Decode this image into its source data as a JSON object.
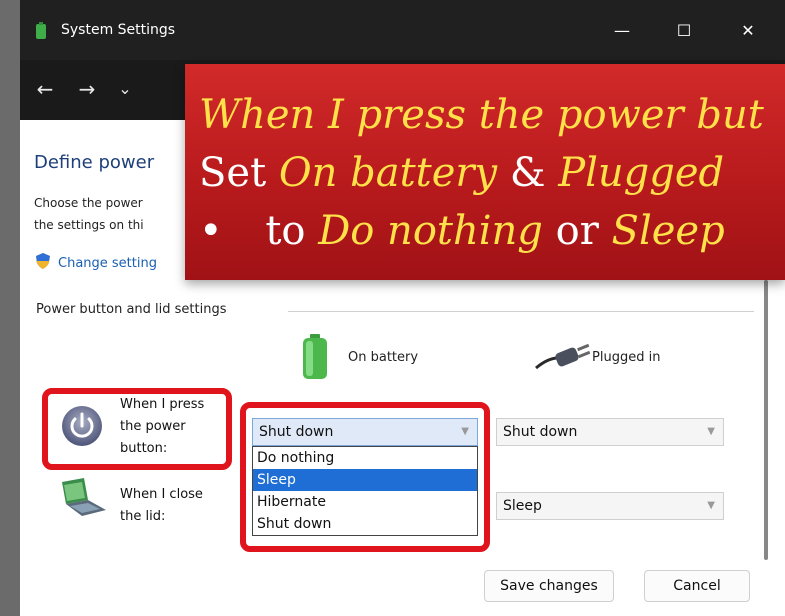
{
  "window": {
    "title": "System Settings",
    "controls": {
      "minimize": "—",
      "maximize": "☐",
      "close": "✕"
    }
  },
  "nav": {
    "back": "←",
    "forward": "→",
    "recent": "⌄"
  },
  "page": {
    "heading_partial": "Define power",
    "desc_line1": "Choose the power",
    "desc_line2": "the settings on thi",
    "change_link": "Change setting"
  },
  "section": {
    "label": "Power button and lid settings",
    "col_battery": "On battery",
    "col_plugged": "Plugged in"
  },
  "rows": {
    "power_button": {
      "label_l1": "When I press",
      "label_l2": "the power",
      "label_l3": "button:",
      "battery_value": "Shut down",
      "plugged_value": "Shut down"
    },
    "lid": {
      "label_l1": "When I close",
      "label_l2": "the lid:",
      "plugged_value": "Sleep"
    }
  },
  "dropdown": {
    "options": [
      "Do nothing",
      "Sleep",
      "Hibernate",
      "Shut down"
    ],
    "highlighted": "Sleep"
  },
  "buttons": {
    "save": "Save changes",
    "cancel": "Cancel"
  },
  "banner": {
    "line1": "When I press the power but",
    "line2_a": "Set ",
    "line2_b": "On battery",
    "line2_c": " & ",
    "line2_d": "Plugged",
    "line3_bullet": "•",
    "line3_a": "to ",
    "line3_b": "Do nothing",
    "line3_c": " or ",
    "line3_d": "Sleep"
  },
  "colors": {
    "highlight_red": "#e0141c",
    "banner_red": "#c02020",
    "banner_yellow": "#ffe14a",
    "selection_blue": "#1e6ed6"
  }
}
